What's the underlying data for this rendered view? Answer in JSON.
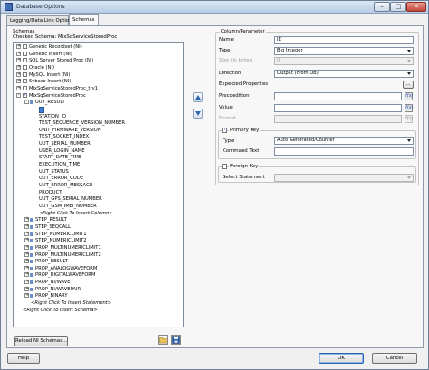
{
  "window": {
    "title": "Database Options",
    "btn_min": "–",
    "btn_max": "□",
    "btn_close": "✕"
  },
  "tabs": [
    {
      "label": "Logging/Data Link Options"
    },
    {
      "label": "Schemas"
    }
  ],
  "schemas": {
    "group_label": "Schemas",
    "checked_label": "Checked Schema: MixSqServiceStoredProc",
    "tree": [
      {
        "label": "Generic Recordset (NI)",
        "level": 0,
        "checked": false,
        "expander": "+"
      },
      {
        "label": "Generic Insert (NI)",
        "level": 0,
        "checked": false,
        "expander": "+"
      },
      {
        "label": "SQL Server Stored Proc (NI)",
        "level": 0,
        "checked": false,
        "expander": "+"
      },
      {
        "label": "Oracle (NI)",
        "level": 0,
        "checked": false,
        "expander": "+"
      },
      {
        "label": "MySQL Insert (NI)",
        "level": 0,
        "checked": false,
        "expander": "+"
      },
      {
        "label": "Sybase Insert (NI)",
        "level": 0,
        "checked": false,
        "expander": "+"
      },
      {
        "label": "MixSqServiceStoredProc_try1",
        "level": 0,
        "checked": false,
        "expander": "+"
      },
      {
        "label": "MixSqServiceStoredProc",
        "level": 0,
        "checked": true,
        "expander": "-"
      },
      {
        "label": "UUT_RESULT",
        "level": 1,
        "expander": "-"
      },
      {
        "label": "",
        "level": 2,
        "selected": true
      },
      {
        "label": "STATION_ID",
        "level": 2
      },
      {
        "label": "TEST_SEQUENCE_VERSION_NUMBER",
        "level": 2
      },
      {
        "label": "UNIT_FIRMWARE_VERSION",
        "level": 2
      },
      {
        "label": "TEST_SOCKET_INDEX",
        "level": 2
      },
      {
        "label": "UUT_SERIAL_NUMBER",
        "level": 2
      },
      {
        "label": "USER_LOGIN_NAME",
        "level": 2
      },
      {
        "label": "START_DATE_TIME",
        "level": 2
      },
      {
        "label": "EXECUTION_TIME",
        "level": 2
      },
      {
        "label": "UUT_STATUS",
        "level": 2
      },
      {
        "label": "UUT_ERROR_CODE",
        "level": 2
      },
      {
        "label": "UUT_ERROR_MESSAGE",
        "level": 2
      },
      {
        "label": "PRODUCT",
        "level": 2
      },
      {
        "label": "UUT_GPS_SERIAL_NUMBER",
        "level": 2
      },
      {
        "label": "UUT_GSM_IMEI_NUMBER",
        "level": 2
      },
      {
        "label": "<Right Click To Insert Column>",
        "level": 2,
        "italic": true
      },
      {
        "label": "STEP_RESULT",
        "level": 1,
        "expander": "+"
      },
      {
        "label": "STEP_SEQCALL",
        "level": 1,
        "expander": "+"
      },
      {
        "label": "STEP_NUMERICLIMIT1",
        "level": 1,
        "expander": "+"
      },
      {
        "label": "STEP_NUMERICLIMIT2",
        "level": 1,
        "expander": "+"
      },
      {
        "label": "PROP_MULTINUMERICLIMIT1",
        "level": 1,
        "expander": "+"
      },
      {
        "label": "PROP_MULTINUMERICLIMIT2",
        "level": 1,
        "expander": "+"
      },
      {
        "label": "PROP_RESULT",
        "level": 1,
        "expander": "+"
      },
      {
        "label": "PROP_ANALOGWAVEFORM",
        "level": 1,
        "expander": "+"
      },
      {
        "label": "PROP_DIGITALWAVEFORM",
        "level": 1,
        "expander": "+"
      },
      {
        "label": "PROP_NI/WAVE",
        "level": 1,
        "expander": "+"
      },
      {
        "label": "PROP_NI/WAVEPAIR",
        "level": 1,
        "expander": "+"
      },
      {
        "label": "PROP_BINARY",
        "level": 1,
        "expander": "+"
      },
      {
        "label": "<Right Click To Insert Statement>",
        "level": 1,
        "italic": true
      },
      {
        "label": "<Right Click To Insert Schema>",
        "level": 0,
        "italic": true
      }
    ],
    "reload_button": "Reload NI Schemas..."
  },
  "column": {
    "group_label": "Column/Parameter",
    "name_label": "Name",
    "name_value": "ID",
    "type_label": "Type",
    "type_value": "Big Integer",
    "size_label": "Size (in bytes)",
    "size_value": "0",
    "direction_label": "Direction",
    "direction_value": "Output (From DB)",
    "expected_label": "Expected Properties",
    "precondition_label": "Precondition",
    "value_label": "Value",
    "format_label": "Format",
    "fx_symbol": "f(x)",
    "browse": "...",
    "primary_key_label": "Primary Key",
    "primary_key_checked": true,
    "pk_type_label": "Type",
    "pk_type_value": "Auto Generated/Counter",
    "command_text_label": "Command Text",
    "foreign_key_label": "Foreign Key",
    "foreign_key_checked": false,
    "select_statement_label": "Select Statement"
  },
  "footer": {
    "help": "Help",
    "ok": "OK",
    "cancel": "Cancel"
  }
}
